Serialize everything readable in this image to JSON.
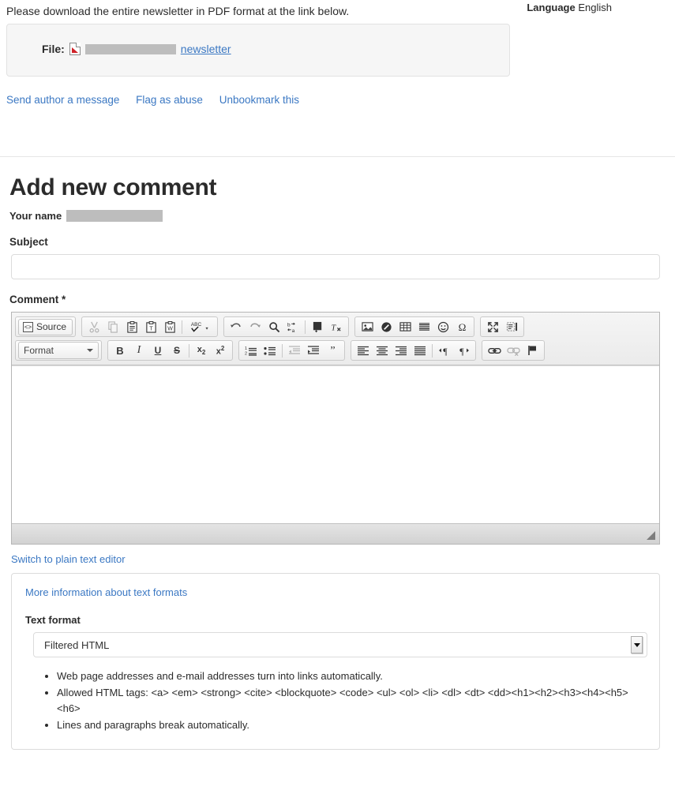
{
  "top": {
    "intro_text": "Please download the entire newsletter in PDF format at the link below.",
    "language_label": "Language",
    "language_value": "English",
    "file_label": "File:",
    "file_icon": "pdf-file-icon",
    "file_name_redacted": "",
    "file_link_text": "newsletter",
    "actions": [
      {
        "label": "Send author a message",
        "name": "send-author-a-message-link"
      },
      {
        "label": "Flag as abuse",
        "name": "flag-as-abuse-link"
      },
      {
        "label": "Unbookmark this",
        "name": "unbookmark-this-link"
      }
    ]
  },
  "form": {
    "title": "Add new comment",
    "your_name_label": "Your name",
    "your_name_value_redacted": "",
    "subject_label": "Subject",
    "subject_value": "",
    "subject_placeholder": "",
    "comment_label": "Comment *",
    "comment_value": "",
    "switch_plain_text_link": "Switch to plain text editor"
  },
  "editor": {
    "source_button_label": "Source",
    "format_combo_label": "Format",
    "toolbar_row1": [
      {
        "name": "cut-icon",
        "glyph": "✂",
        "disabled": true
      },
      {
        "name": "copy-icon",
        "glyph": "❐",
        "disabled": true
      },
      {
        "name": "paste-icon",
        "glyph": "ὌB",
        "disabled": false
      },
      {
        "name": "paste-as-plain-text-icon",
        "glyph": "T",
        "disabled": false
      },
      {
        "name": "paste-from-word-icon",
        "glyph": "W",
        "disabled": false
      },
      {
        "name": "spell-check-as-you-type-icon",
        "glyph": "ABC",
        "disabled": false
      },
      {
        "name": "undo-icon",
        "glyph": "↩",
        "disabled": false
      },
      {
        "name": "redo-icon",
        "glyph": "↪",
        "disabled": false
      },
      {
        "name": "find-icon",
        "glyph": "ὐD",
        "disabled": false
      },
      {
        "name": "replace-icon",
        "glyph": "b→a",
        "disabled": false
      },
      {
        "name": "select-all-icon",
        "glyph": "≡",
        "disabled": false
      },
      {
        "name": "remove-format-icon",
        "glyph": "Tx",
        "disabled": false
      },
      {
        "name": "image-icon",
        "glyph": "ὛC",
        "disabled": false
      },
      {
        "name": "flash-icon",
        "glyph": "◐",
        "disabled": false
      },
      {
        "name": "table-icon",
        "glyph": "▦",
        "disabled": false
      },
      {
        "name": "horizontal-rule-icon",
        "glyph": "☰",
        "disabled": false
      },
      {
        "name": "smiley-icon",
        "glyph": "☺",
        "disabled": false
      },
      {
        "name": "special-character-icon",
        "glyph": "Ω",
        "disabled": false
      },
      {
        "name": "maximize-icon",
        "glyph": "⤢",
        "disabled": false
      },
      {
        "name": "show-blocks-icon",
        "glyph": "▤",
        "disabled": false
      }
    ],
    "toolbar_row2": [
      {
        "name": "bold-icon",
        "glyph": "B",
        "disabled": false
      },
      {
        "name": "italic-icon",
        "glyph": "I",
        "disabled": false
      },
      {
        "name": "underline-icon",
        "glyph": "U",
        "disabled": false
      },
      {
        "name": "strikethrough-icon",
        "glyph": "S",
        "disabled": false
      },
      {
        "name": "subscript-icon",
        "glyph": "x₂",
        "disabled": false
      },
      {
        "name": "superscript-icon",
        "glyph": "x²",
        "disabled": false
      },
      {
        "name": "numbered-list-icon",
        "glyph": "1≡",
        "disabled": false
      },
      {
        "name": "bulleted-list-icon",
        "glyph": "•≡",
        "disabled": false
      },
      {
        "name": "decrease-indent-icon",
        "glyph": "⇤",
        "disabled": true
      },
      {
        "name": "increase-indent-icon",
        "glyph": "⇥",
        "disabled": false
      },
      {
        "name": "blockquote-icon",
        "glyph": "”",
        "disabled": false
      },
      {
        "name": "align-left-icon",
        "glyph": "≡",
        "disabled": false
      },
      {
        "name": "align-center-icon",
        "glyph": "≡",
        "disabled": false
      },
      {
        "name": "align-right-icon",
        "glyph": "≡",
        "disabled": false
      },
      {
        "name": "justify-icon",
        "glyph": "≡",
        "disabled": false
      },
      {
        "name": "text-direction-ltr-icon",
        "glyph": "¶",
        "disabled": false
      },
      {
        "name": "text-direction-rtl-icon",
        "glyph": "¶",
        "disabled": false
      },
      {
        "name": "link-icon",
        "glyph": "ὑ7",
        "disabled": false
      },
      {
        "name": "unlink-icon",
        "glyph": "ὑ7",
        "disabled": true
      },
      {
        "name": "anchor-icon",
        "glyph": "⚑",
        "disabled": false
      }
    ]
  },
  "text_format": {
    "more_info_link": "More information about text formats",
    "label": "Text format",
    "selected": "Filtered HTML",
    "options": [
      "Filtered HTML"
    ],
    "help_items": [
      "Web page addresses and e-mail addresses turn into links automatically.",
      "Allowed HTML tags: <a> <em> <strong> <cite> <blockquote> <code> <ul> <ol> <li> <dl> <dt> <dd><h1><h2><h3><h4><h5><h6>",
      "Lines and paragraphs break automatically."
    ]
  },
  "colors": {
    "link": "#3b78c3",
    "text": "#2b2b2b",
    "panel_border": "#dcdcdc",
    "file_box_bg": "#f6f6f6",
    "redaction": "#bdbdbd"
  }
}
